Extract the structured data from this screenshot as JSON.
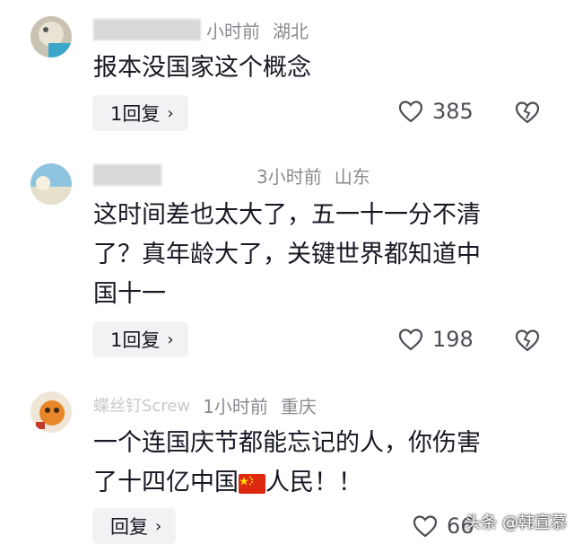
{
  "comments": [
    {
      "username": "",
      "time": "小时前",
      "location": "湖北",
      "text": "报本没国家这个概念",
      "reply_label": "1回复",
      "likes": "385"
    },
    {
      "username": "",
      "time": "3小时前",
      "location": "山东",
      "text_line1": "这时间差也太大了，五一十一分不清",
      "text_line2": "了？真年龄大了，关键世界都知道中",
      "text_line3": "国十一",
      "reply_label": "1回复",
      "likes": "198"
    },
    {
      "username": "蝶丝钉Screw",
      "time": "1小时前",
      "location": "重庆",
      "text_line1": "一个连国庆节都能忘记的人，你伤害",
      "text_line2_a": "了十四亿中国",
      "text_line2_b": "人民！！",
      "reply_label": "回复",
      "likes": "66"
    }
  ],
  "watermark": "头条 @韩宣慕",
  "icons": {
    "like": "heart-outline-icon",
    "dislike": "broken-heart-icon",
    "flag": "china-flag-icon",
    "chevron": "chevron-right-icon"
  }
}
